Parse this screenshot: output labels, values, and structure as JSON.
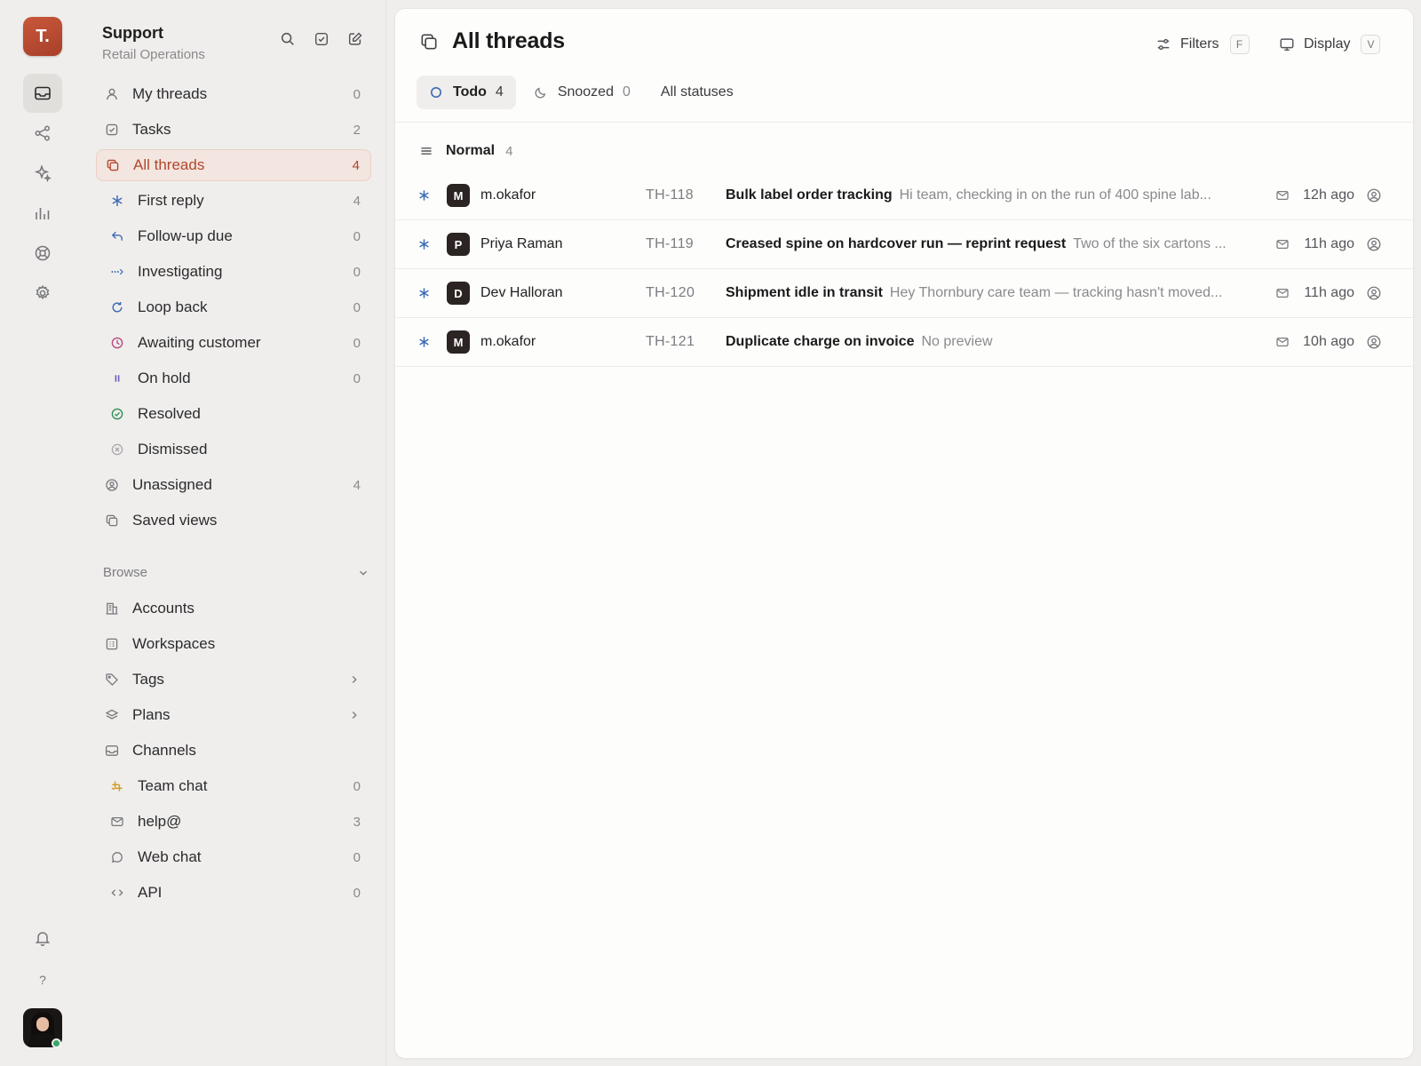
{
  "app": {
    "org_initial": "T.",
    "accent_color": "#b0472c",
    "rail": [
      {
        "name": "inbox",
        "icon": "inbox-icon",
        "active": true
      },
      {
        "name": "share",
        "icon": "share-icon"
      },
      {
        "name": "ai",
        "icon": "sparkle-icon"
      },
      {
        "name": "reports",
        "icon": "bar-chart-icon"
      },
      {
        "name": "help-center",
        "icon": "lifebuoy-icon"
      },
      {
        "name": "settings",
        "icon": "gear-icon"
      }
    ],
    "help_label": "?"
  },
  "workspace": {
    "name": "Support",
    "subtitle": "Retail Operations"
  },
  "sidebar": {
    "items": [
      {
        "label": "My threads",
        "count": "0",
        "icon": "user-icon"
      },
      {
        "label": "Tasks",
        "count": "2",
        "icon": "checkbox-icon"
      },
      {
        "label": "All threads",
        "count": "4",
        "icon": "threads-icon",
        "active": true
      },
      {
        "label": "First reply",
        "count": "4",
        "icon": "asterisk-icon",
        "sub": true
      },
      {
        "label": "Follow-up due",
        "count": "0",
        "icon": "reply-icon",
        "sub": true
      },
      {
        "label": "Investigating",
        "count": "0",
        "icon": "dots-arrow-icon",
        "sub": true
      },
      {
        "label": "Loop back",
        "count": "0",
        "icon": "refresh-icon",
        "sub": true
      },
      {
        "label": "Awaiting customer",
        "count": "0",
        "icon": "clock-icon",
        "sub": true
      },
      {
        "label": "On hold",
        "count": "0",
        "icon": "pause-icon",
        "sub": true
      },
      {
        "label": "Resolved",
        "count": "",
        "icon": "check-circle-icon",
        "sub": true
      },
      {
        "label": "Dismissed",
        "count": "",
        "icon": "x-circle-icon",
        "sub": true
      },
      {
        "label": "Unassigned",
        "count": "4",
        "icon": "user-circle-icon"
      },
      {
        "label": "Saved views",
        "count": "",
        "icon": "copy-icon"
      }
    ],
    "browse_label": "Browse",
    "browse": [
      {
        "label": "Accounts",
        "icon": "building-icon"
      },
      {
        "label": "Workspaces",
        "icon": "grid-icon"
      },
      {
        "label": "Tags",
        "icon": "tag-icon",
        "chevron": true
      },
      {
        "label": "Plans",
        "icon": "layers-icon",
        "chevron": true
      },
      {
        "label": "Channels",
        "icon": "inbox-icon"
      },
      {
        "label": "Team chat",
        "count": "0",
        "icon": "slack-icon",
        "sub": true
      },
      {
        "label": "help@",
        "count": "3",
        "icon": "mail-icon",
        "sub": true
      },
      {
        "label": "Web chat",
        "count": "0",
        "icon": "chat-bubble-icon",
        "sub": true
      },
      {
        "label": "API",
        "count": "0",
        "icon": "code-icon",
        "sub": true
      }
    ]
  },
  "main": {
    "title": "All threads",
    "filters_label": "Filters",
    "filters_key": "F",
    "display_label": "Display",
    "display_key": "V",
    "tabs": [
      {
        "label": "Todo",
        "count": "4",
        "icon": "circle-icon",
        "active": true
      },
      {
        "label": "Snoozed",
        "count": "0",
        "icon": "moon-icon"
      },
      {
        "label": "All statuses",
        "count": "",
        "icon": ""
      }
    ],
    "group": {
      "label": "Normal",
      "count": "4"
    },
    "threads": [
      {
        "initial": "M",
        "author": "m.okafor",
        "id": "TH-118",
        "subject": "Bulk label order tracking",
        "preview": "Hi team, checking in on the run of 400 spine lab...",
        "time": "12h ago"
      },
      {
        "initial": "P",
        "author": "Priya Raman",
        "id": "TH-119",
        "subject": "Creased spine on hardcover run — reprint request",
        "preview": "Two of the six cartons ...",
        "time": "11h ago"
      },
      {
        "initial": "D",
        "author": "Dev Halloran",
        "id": "TH-120",
        "subject": "Shipment idle in transit",
        "preview": "Hey Thornbury care team — tracking hasn't moved...",
        "time": "11h ago"
      },
      {
        "initial": "M",
        "author": "m.okafor",
        "id": "TH-121",
        "subject": "Duplicate charge on invoice",
        "preview": "No preview",
        "time": "10h ago"
      }
    ]
  }
}
